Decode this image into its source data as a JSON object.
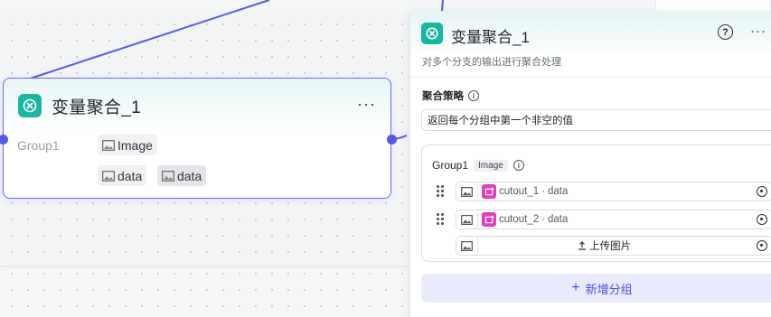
{
  "node": {
    "title": "变量聚合_1",
    "more": "···",
    "group_label": "Group1",
    "outputs": [
      "Image"
    ],
    "inputs": [
      "data",
      "data"
    ]
  },
  "panel": {
    "title": "变量聚合_1",
    "help": "?",
    "more": "···",
    "description": "对多个分支的输出进行聚合处理",
    "strategy_label": "聚合策略",
    "info": "i",
    "strategy_value": "返回每个分组中第一个非空的值",
    "group": {
      "name": "Group1",
      "type_badge": "Image",
      "info": "i",
      "rows": [
        {
          "source": "cutout_1",
          "sep": " · ",
          "field": "data"
        },
        {
          "source": "cutout_2",
          "sep": " · ",
          "field": "data"
        }
      ],
      "upload_label": "上传图片"
    },
    "add_group_label": "新增分组",
    "add_group_plus": "+"
  },
  "colors": {
    "accent": "#5558e8",
    "node_icon": "#19b6a3",
    "variable_icon": "#e43fbb",
    "add_group_bg": "#e9eafd"
  },
  "icons": [
    "aggregate-icon",
    "image-icon",
    "drag-handle-icon",
    "variable-select-icon",
    "upload-icon",
    "plus-icon",
    "help-icon",
    "more-icon",
    "info-icon"
  ]
}
